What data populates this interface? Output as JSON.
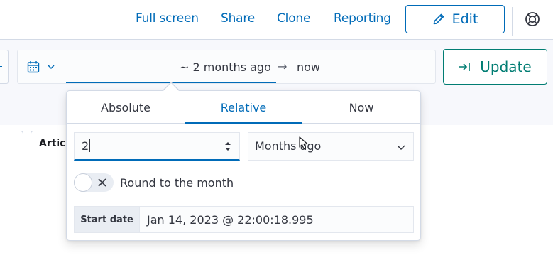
{
  "header": {
    "links": [
      "Full screen",
      "Share",
      "Clone",
      "Reporting"
    ],
    "edit_label": "Edit",
    "help_icon": "help-lifebuoy-icon"
  },
  "date_picker": {
    "quick_select_icon": "calendar-icon",
    "start": "~ 2 months ago",
    "arrow": "→",
    "end": "now"
  },
  "update_label": "Update",
  "panel": {
    "title": "Artic"
  },
  "popover": {
    "tabs": [
      "Absolute",
      "Relative",
      "Now"
    ],
    "active_tab": "Relative",
    "count_value": "2",
    "unit_value": "Months ago",
    "round_label": "Round to the month",
    "round_enabled": false,
    "start_date_label": "Start date",
    "start_date_value": "Jan 14, 2023 @ 22:00:18.995"
  },
  "colors": {
    "primary": "#006bb8",
    "success": "#017d73",
    "border": "#d3dae6"
  }
}
